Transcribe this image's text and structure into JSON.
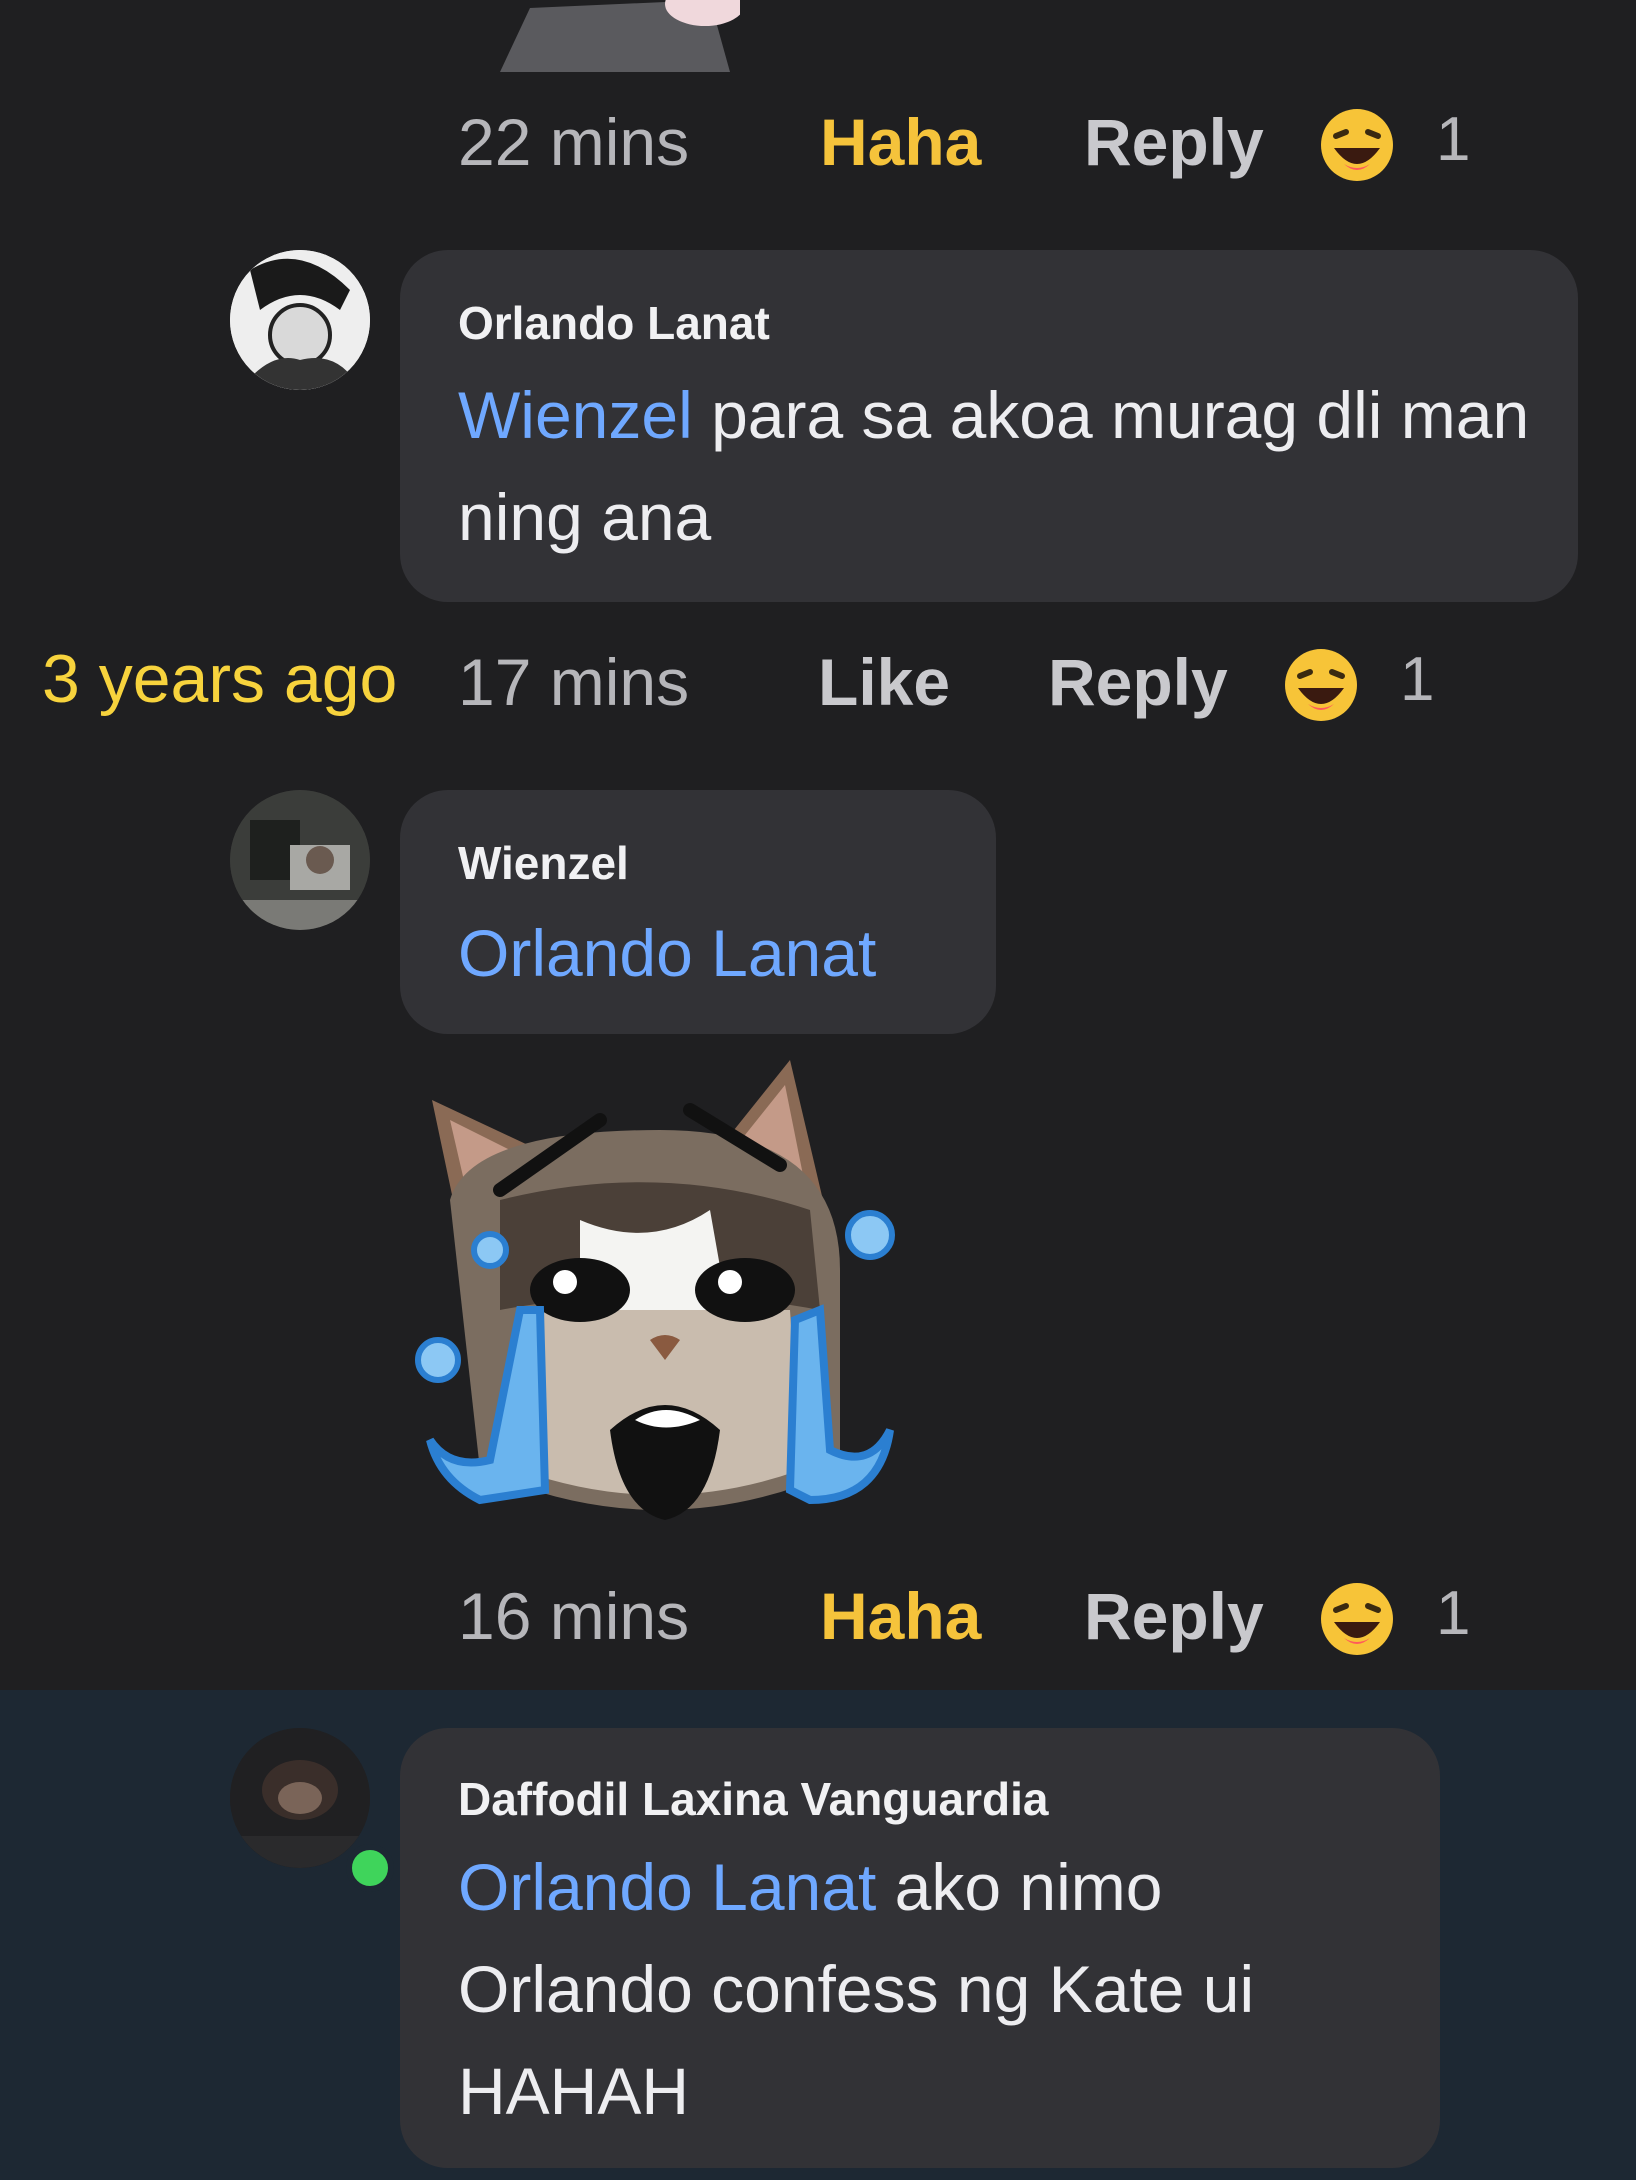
{
  "overlay": {
    "timestamp": "3 years ago"
  },
  "comments": [
    {
      "time": "22 mins",
      "action_primary": "Haha",
      "action_reply": "Reply",
      "reaction_count": "1"
    },
    {
      "author": "Orlando Lanat",
      "mention": "Wienzel",
      "text": " para sa akoa murag dli man ning ana",
      "time": "17 mins",
      "action_primary": "Like",
      "action_reply": "Reply",
      "reaction_count": "1"
    },
    {
      "author": "Wienzel",
      "mention": "Orlando Lanat",
      "text": "",
      "sticker": "crying-cat-sticker",
      "time": "16 mins",
      "action_primary": "Haha",
      "action_reply": "Reply",
      "reaction_count": "1"
    },
    {
      "author": "Daffodil Laxina Vanguardia",
      "mention": "Orlando Lanat",
      "text": " ako nimo Orlando confess ng Kate ui HAHAH",
      "online": true
    }
  ],
  "colors": {
    "background": "#1f1f21",
    "bubble": "#323236",
    "mention": "#6fa8ff",
    "haha_active": "#f5c33b",
    "overlay_text": "#f7d33d",
    "online": "#3fd45b"
  },
  "icons": {
    "reaction": "haha-emoji-icon"
  }
}
